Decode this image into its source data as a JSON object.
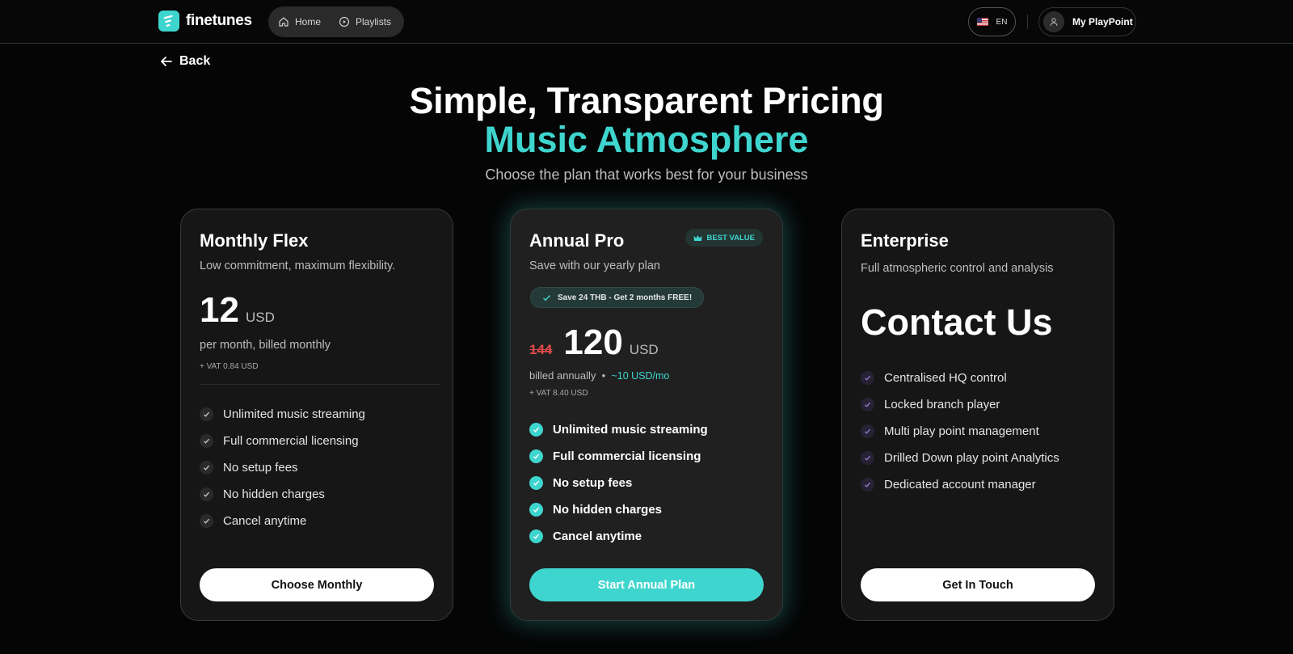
{
  "brand": {
    "name": "finetunes",
    "accent": "#3fd5cf"
  },
  "nav": [
    {
      "label": "Home",
      "icon": "home-icon"
    },
    {
      "label": "Playlists",
      "icon": "play-circle-icon"
    }
  ],
  "header": {
    "language": "EN",
    "account_label": "My PlayPoint"
  },
  "back_label": "Back",
  "hero": {
    "title": "Simple, Transparent Pricing",
    "subtitle": "Music Atmosphere",
    "description": "Choose the plan that works best for your business"
  },
  "plans": [
    {
      "name": "Monthly Flex",
      "description": "Low commitment, maximum flexibility.",
      "price": "12",
      "currency": "USD",
      "billing": "per month, billed monthly",
      "vat": "+ VAT 0.84 USD",
      "features": [
        "Unlimited music streaming",
        "Full commercial licensing",
        "No setup fees",
        "No hidden charges",
        "Cancel anytime"
      ],
      "cta": "Choose Monthly"
    },
    {
      "name": "Annual Pro",
      "badge": "BEST VALUE",
      "description": "Save with our yearly plan",
      "savings": "Save 24 THB - Get 2 months FREE!",
      "old_price": "144",
      "price": "120",
      "currency": "USD",
      "billing": "billed annually",
      "billing_separator": "•",
      "monthly_equivalent": "~10 USD/mo",
      "vat": "+ VAT 8.40 USD",
      "features": [
        "Unlimited music streaming",
        "Full commercial licensing",
        "No setup fees",
        "No hidden charges",
        "Cancel anytime"
      ],
      "cta": "Start Annual Plan"
    },
    {
      "name": "Enterprise",
      "description": "Full atmospheric control and analysis",
      "price_text": "Contact Us",
      "features": [
        "Centralised HQ control",
        "Locked branch player",
        "Multi play point management",
        "Drilled Down play point Analytics",
        "Dedicated account manager"
      ],
      "cta": "Get In Touch"
    }
  ]
}
